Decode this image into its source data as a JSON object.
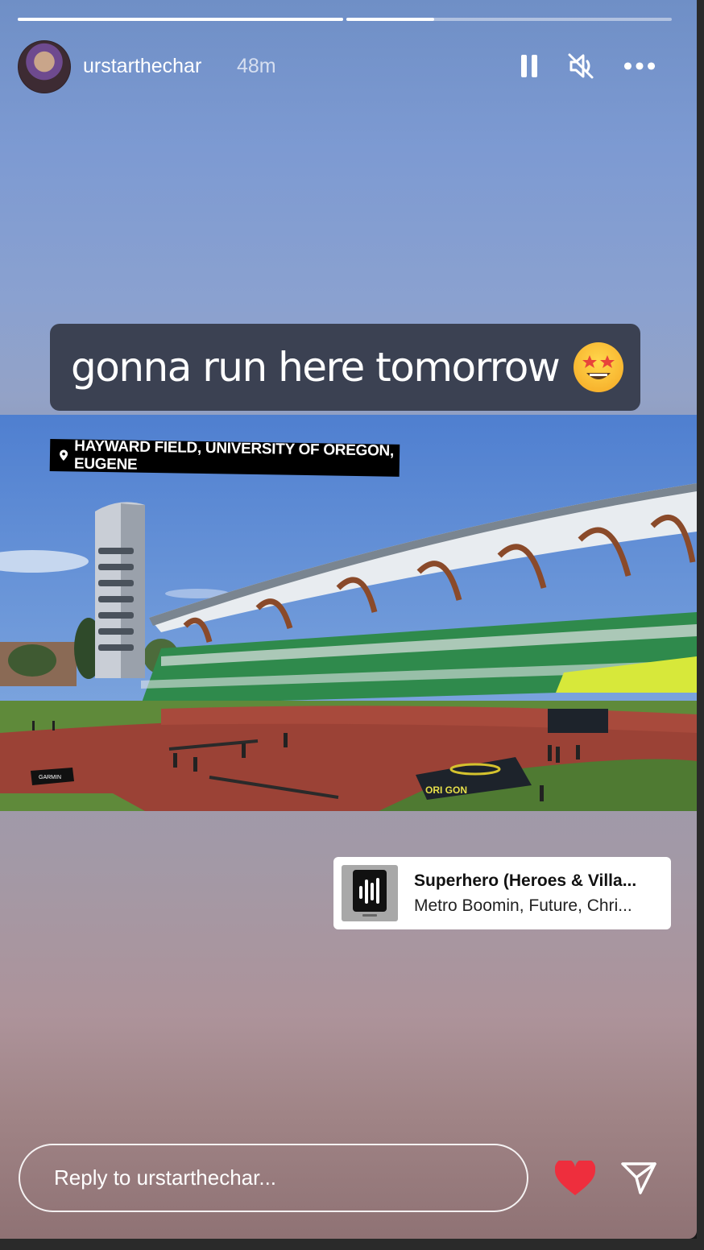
{
  "story": {
    "username": "urstarthechar",
    "time_ago": "48m",
    "progress": [
      1.0,
      0.27
    ]
  },
  "caption": {
    "text": "gonna run here tomorrow",
    "emoji_icon": "star-struck-emoji"
  },
  "location_sticker": {
    "text": "HAYWARD FIELD, UNIVERSITY OF OREGON, EUGENE"
  },
  "photo_signage": {
    "garmin": "GARMIN",
    "oregon": "ORI GON"
  },
  "music": {
    "title": "Superhero (Heroes & Villa...",
    "artist": "Metro Boomin, Future, Chri..."
  },
  "reply": {
    "placeholder": "Reply to urstarthechar..."
  },
  "colors": {
    "like": "#ee2e3d",
    "caption_bg": "#3b4152"
  }
}
